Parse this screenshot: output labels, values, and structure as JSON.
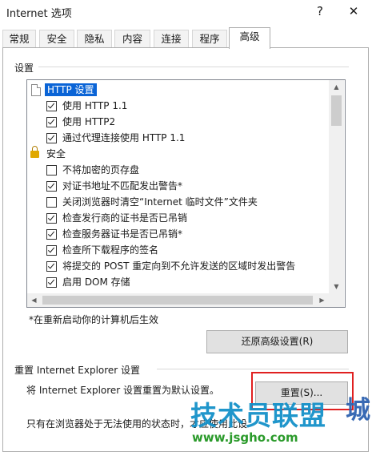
{
  "window": {
    "title": "Internet 选项",
    "help_icon": "?",
    "close_icon": "✕"
  },
  "tabs": [
    {
      "label": "常规",
      "active": false
    },
    {
      "label": "安全",
      "active": false
    },
    {
      "label": "隐私",
      "active": false
    },
    {
      "label": "内容",
      "active": false
    },
    {
      "label": "连接",
      "active": false
    },
    {
      "label": "程序",
      "active": false
    },
    {
      "label": "高级",
      "active": true
    }
  ],
  "settings": {
    "group_label": "设置",
    "tree": [
      {
        "type": "category",
        "icon": "document-icon",
        "label": "HTTP 设置",
        "selected": true
      },
      {
        "type": "option",
        "checked": true,
        "label": "使用 HTTP 1.1"
      },
      {
        "type": "option",
        "checked": true,
        "label": "使用 HTTP2"
      },
      {
        "type": "option",
        "checked": true,
        "label": "通过代理连接使用 HTTP 1.1"
      },
      {
        "type": "category",
        "icon": "lock-icon",
        "label": "安全",
        "selected": false
      },
      {
        "type": "option",
        "checked": false,
        "label": "不将加密的页存盘"
      },
      {
        "type": "option",
        "checked": true,
        "label": "对证书地址不匹配发出警告*"
      },
      {
        "type": "option",
        "checked": false,
        "label": "关闭浏览器时清空“Internet 临时文件”文件夹"
      },
      {
        "type": "option",
        "checked": true,
        "label": "检查发行商的证书是否已吊销"
      },
      {
        "type": "option",
        "checked": true,
        "label": "检查服务器证书是否已吊销*"
      },
      {
        "type": "option",
        "checked": true,
        "label": "检查所下载程序的签名"
      },
      {
        "type": "option",
        "checked": true,
        "label": "将提交的 POST 重定向到不允许发送的区域时发出警告"
      },
      {
        "type": "option",
        "checked": true,
        "label": "启用 DOM 存储"
      }
    ],
    "note": "*在重新启动你的计算机后生效",
    "restore_button": "还原高级设置(R)"
  },
  "reset": {
    "group_label": "重置 Internet Explorer 设置",
    "description": "将 Internet Explorer 设置重置为默认设置。",
    "button": "重置(S)...",
    "bottom_text": "只有在浏览器处于无法使用的状态时，才应使用此设"
  },
  "watermark": {
    "text": "技术员联盟",
    "accent": "城",
    "url": "www.jsgho.com"
  },
  "colors": {
    "selection": "#0a64d6",
    "highlight_box": "#e02020",
    "watermark_blue": "#1591c9",
    "watermark_green": "#2a9a2a"
  }
}
